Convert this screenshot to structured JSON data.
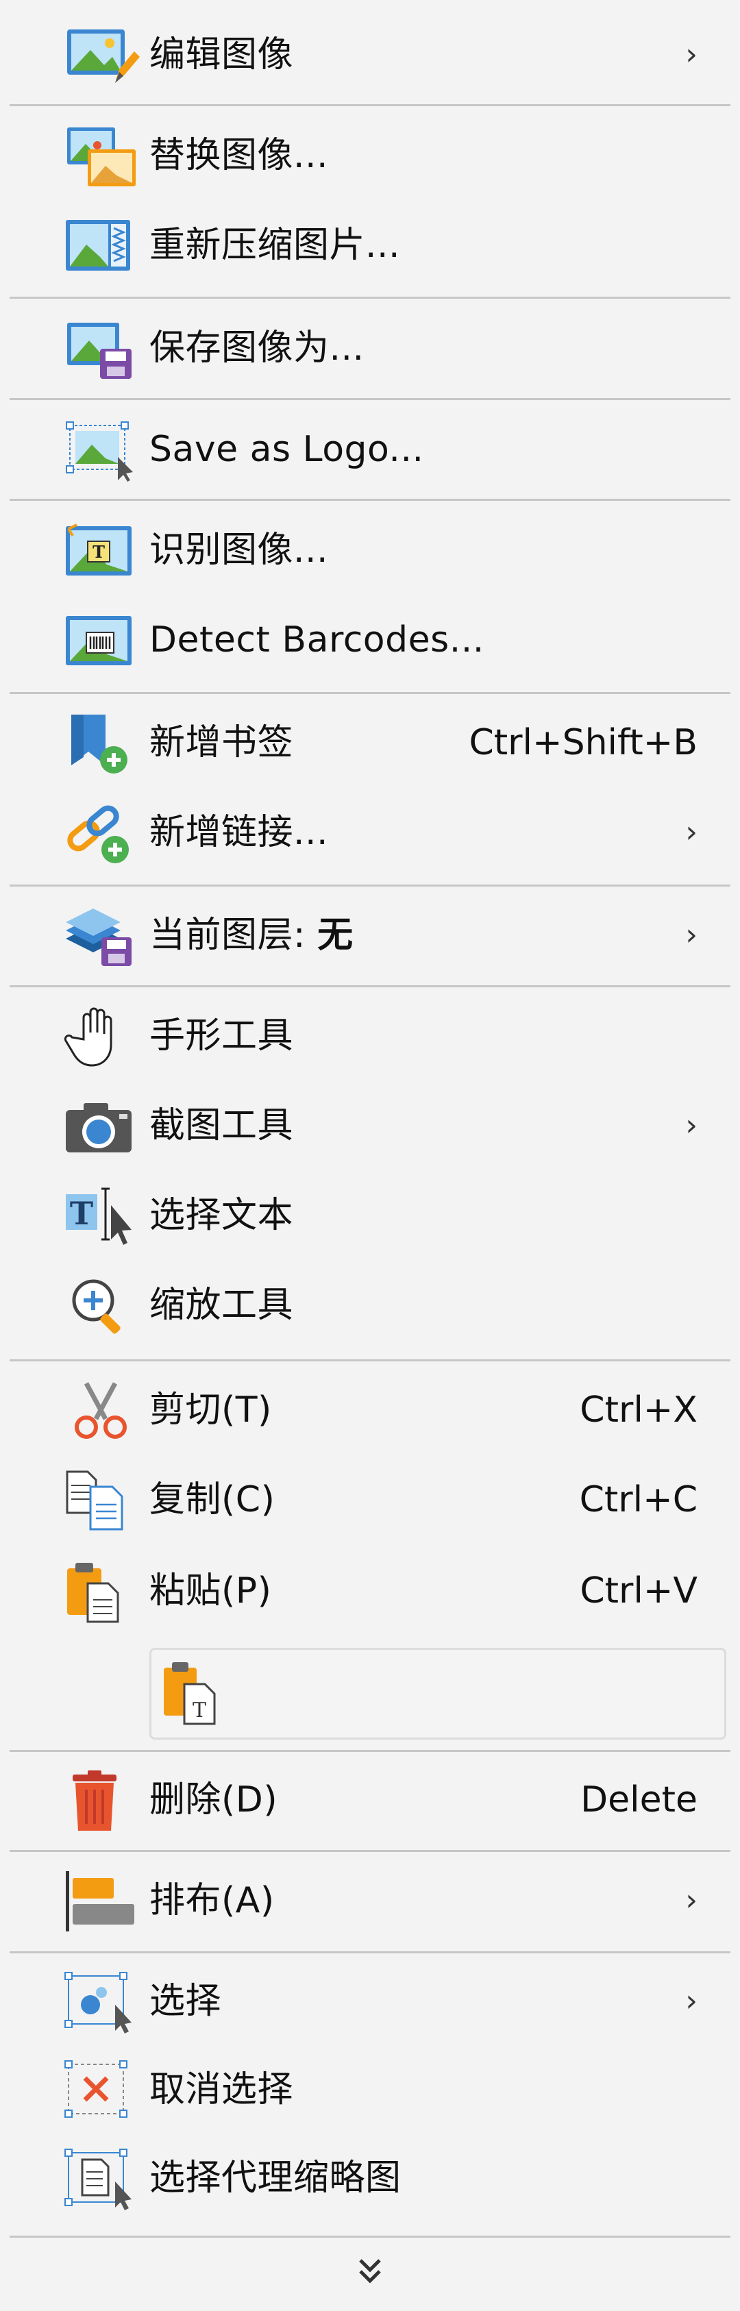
{
  "menu": {
    "edit_image": "编辑图像",
    "replace_image": "替换图像...",
    "recompress_image": "重新压缩图片...",
    "save_image_as": "保存图像为...",
    "save_as_logo": "Save as Logo...",
    "recognize_image": "识别图像...",
    "detect_barcodes": "Detect Barcodes...",
    "add_bookmark": "新增书签",
    "add_bookmark_shortcut": "Ctrl+Shift+B",
    "add_link": "新增链接...",
    "current_layer_prefix": "当前图层: ",
    "current_layer_value": "无",
    "hand_tool": "手形工具",
    "snapshot_tool": "截图工具",
    "select_text": "选择文本",
    "zoom_tool": "缩放工具",
    "cut": "剪切(T)",
    "cut_shortcut": "Ctrl+X",
    "copy": "复制(C)",
    "copy_shortcut": "Ctrl+C",
    "paste": "粘贴(P)",
    "paste_shortcut": "Ctrl+V",
    "delete": "删除(D)",
    "delete_shortcut": "Delete",
    "arrange": "排布(A)",
    "select": "选择",
    "deselect": "取消选择",
    "select_proxy_thumbnail": "选择代理缩略图"
  },
  "icons": {
    "submenu": "chevron-right-icon",
    "more": "double-chevron-down-icon"
  },
  "colors": {
    "background": "#f3f3f3",
    "separator": "#c6c6c6",
    "accent_blue": "#3a86d1",
    "accent_green": "#4caf50",
    "accent_orange": "#f39c12",
    "accent_red": "#e8542e",
    "accent_purple": "#7b4ba6"
  }
}
